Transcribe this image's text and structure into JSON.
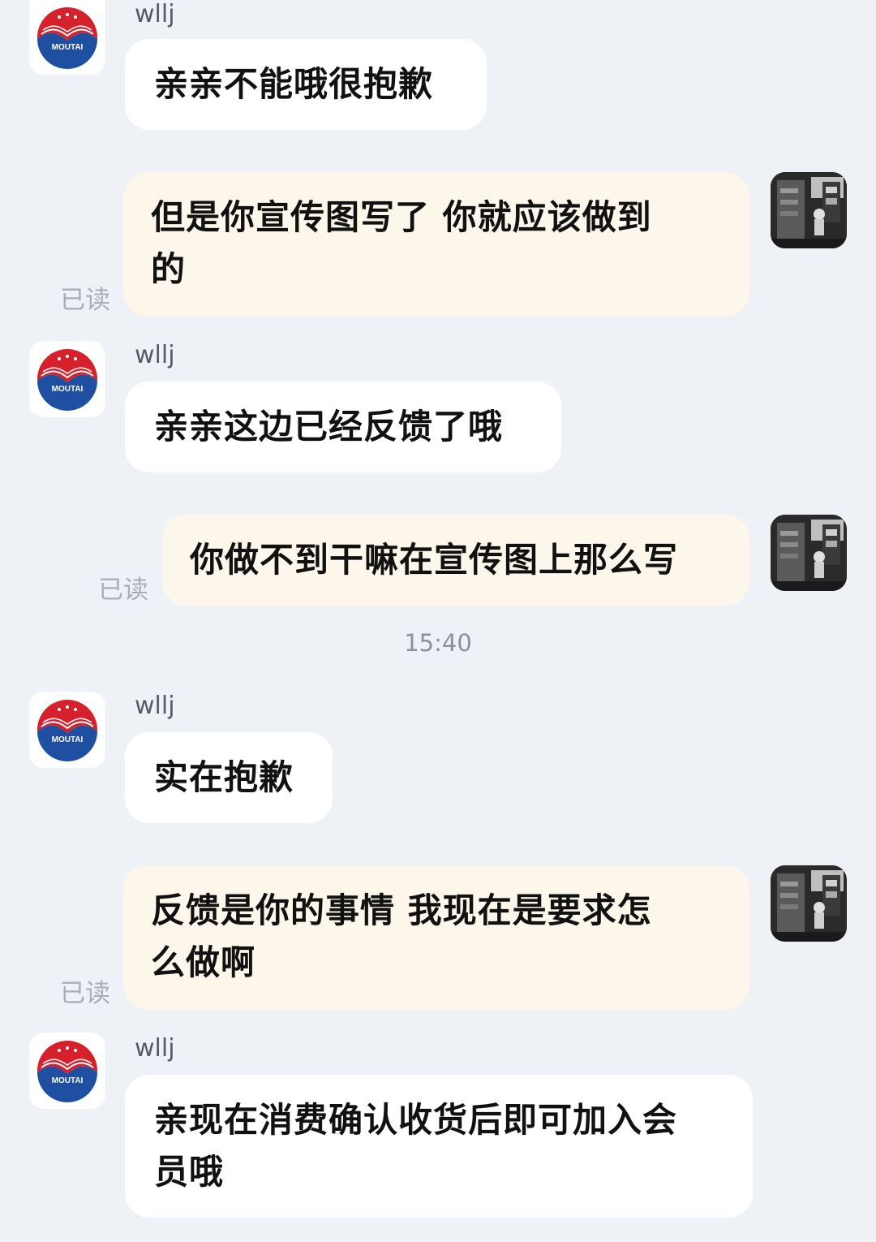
{
  "contact": {
    "name": "wllj",
    "avatar_icon": "moutai-logo-icon",
    "logo_text": "MOUTAI"
  },
  "me": {
    "avatar_icon": "user-photo-avatar"
  },
  "messages": [
    {
      "side": "in",
      "sender": "wllj",
      "text": "亲亲不能哦很抱歉"
    },
    {
      "side": "out",
      "line1": "但是你宣传图写了 你就应该做到",
      "line2": "的",
      "status": "已读"
    },
    {
      "side": "in",
      "sender": "wllj",
      "text": "亲亲这边已经反馈了哦"
    },
    {
      "side": "out",
      "text": "你做不到干嘛在宣传图上那么写",
      "status": "已读"
    },
    {
      "side": "in",
      "sender": "wllj",
      "text": "实在抱歉"
    },
    {
      "side": "out",
      "line1": "反馈是你的事情 我现在是要求怎",
      "line2": "么做啊",
      "status": "已读"
    },
    {
      "side": "in",
      "sender": "wllj",
      "line1": "亲现在消费确认收货后即可加入会",
      "line2": "员哦"
    }
  ],
  "time_divider": "15:40",
  "colors": {
    "background": "#eef2f7",
    "incoming_bubble": "#ffffff",
    "outgoing_bubble": "#fdf6ea",
    "read_status": "#a9aeb6",
    "logo_red": "#d6202b",
    "logo_blue": "#1f4fa0"
  }
}
